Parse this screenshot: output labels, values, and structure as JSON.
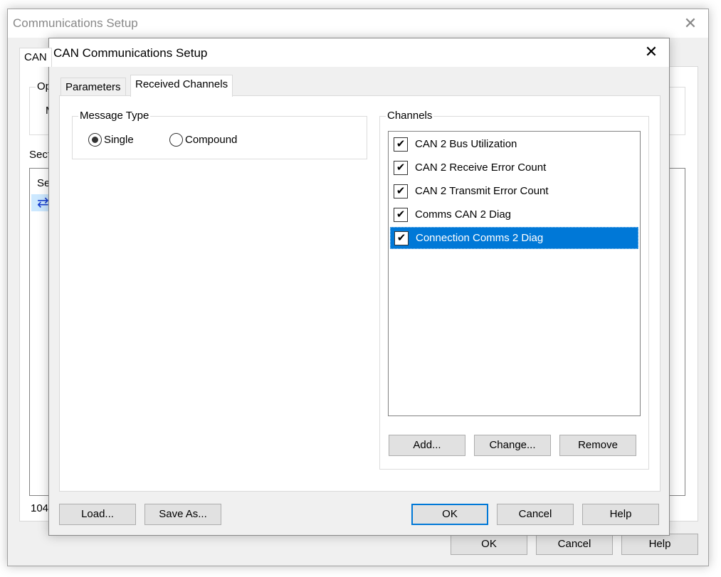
{
  "outer": {
    "title": "Communications Setup",
    "tab": "CAN",
    "group_label": "Op",
    "group_text": "M",
    "section_label": "Sect",
    "list_header": "Se",
    "status": "104",
    "buttons": {
      "ok": "OK",
      "cancel": "Cancel",
      "help": "Help"
    }
  },
  "dialog": {
    "title": "CAN Communications Setup",
    "tabs": [
      {
        "label": "Parameters"
      },
      {
        "label": "Received Channels",
        "selected": true
      }
    ],
    "message_type": {
      "label": "Message Type",
      "options": [
        {
          "label": "Single",
          "checked": true
        },
        {
          "label": "Compound",
          "checked": false
        }
      ]
    },
    "channels": {
      "label": "Channels",
      "items": [
        {
          "label": "CAN 2 Bus Utilization",
          "checked": true
        },
        {
          "label": "CAN 2 Receive Error Count",
          "checked": true
        },
        {
          "label": "CAN 2 Transmit Error Count",
          "checked": true
        },
        {
          "label": "Comms CAN 2 Diag",
          "checked": true
        },
        {
          "label": "Connection Comms 2 Diag",
          "checked": true,
          "selected": true
        }
      ],
      "add": "Add...",
      "change": "Change...",
      "remove": "Remove"
    },
    "buttons": {
      "load": "Load...",
      "save_as": "Save As...",
      "ok": "OK",
      "cancel": "Cancel",
      "help": "Help"
    }
  },
  "colors": {
    "selection": "#0078d7",
    "default_button_border": "#0078d7"
  },
  "icons": {
    "close": "✕",
    "check": "✔",
    "transfer": "⇄"
  }
}
